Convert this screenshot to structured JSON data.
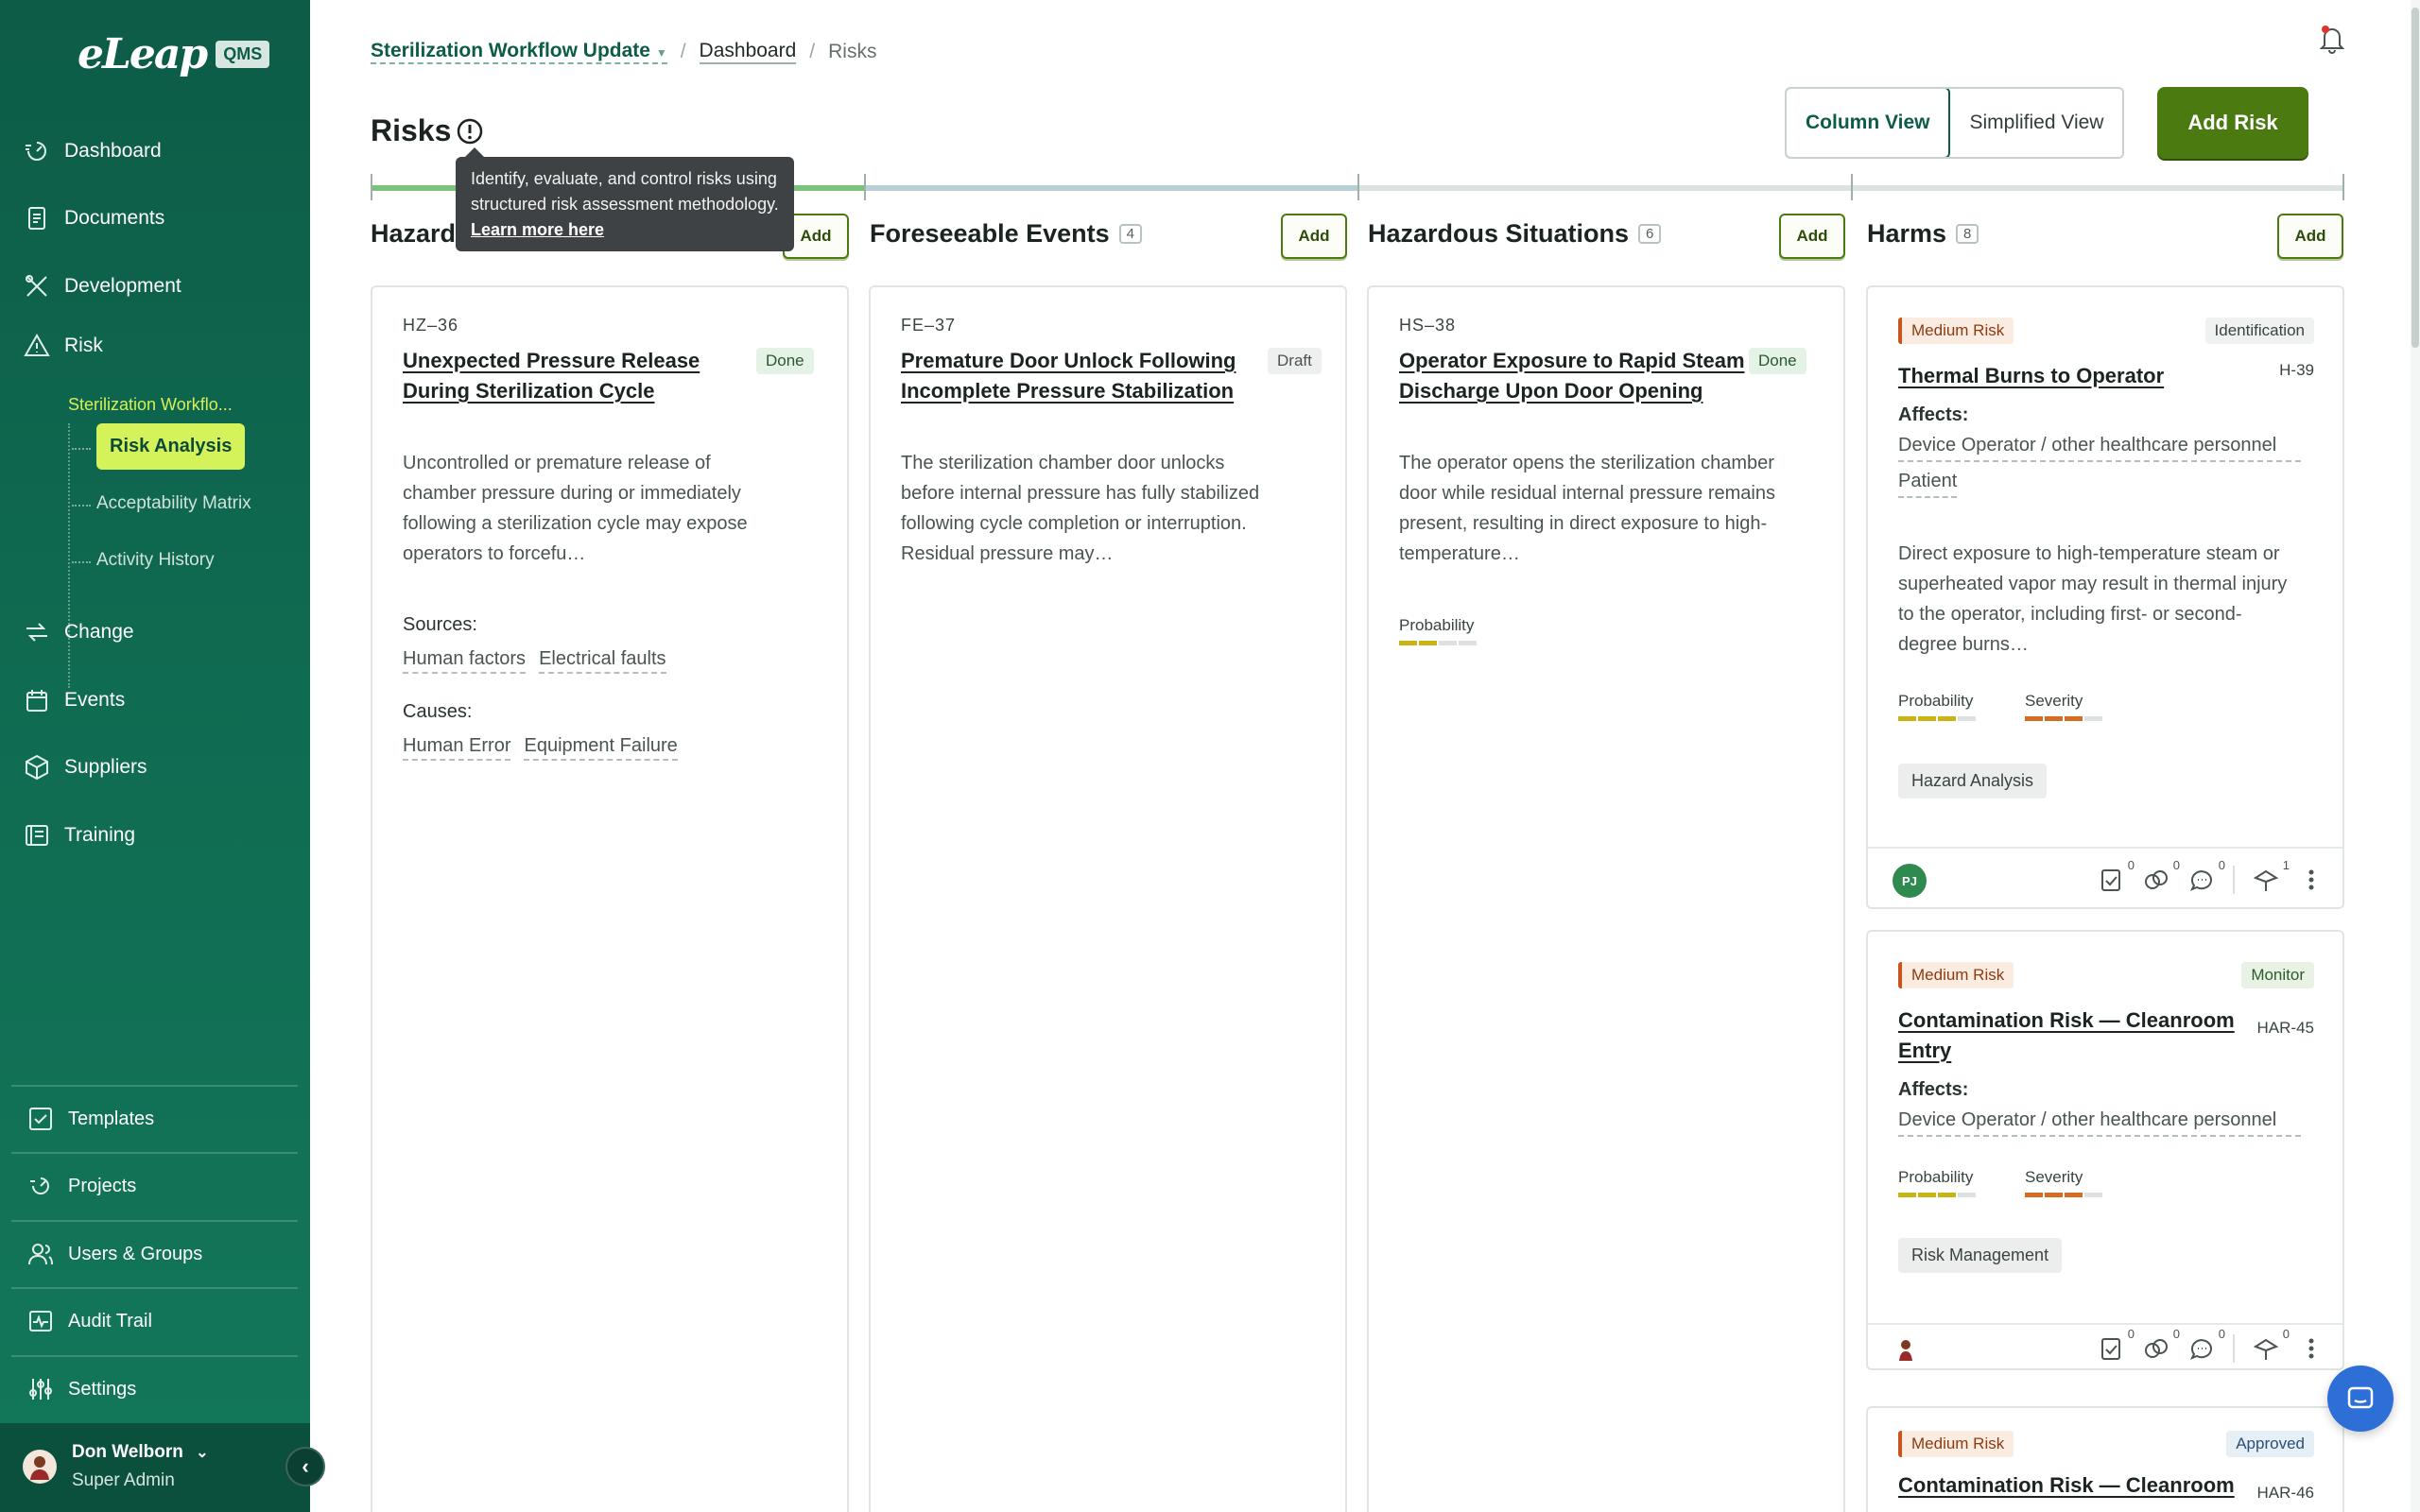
{
  "app": {
    "logo_text": "eLeap",
    "logo_badge": "QMS"
  },
  "sidebar": {
    "items": [
      {
        "label": "Dashboard",
        "icon": "dashboard-icon"
      },
      {
        "label": "Documents",
        "icon": "documents-icon"
      },
      {
        "label": "Development",
        "icon": "development-icon"
      },
      {
        "label": "Risk",
        "icon": "risk-icon"
      },
      {
        "label": "Change",
        "icon": "change-icon"
      },
      {
        "label": "Events",
        "icon": "events-icon"
      },
      {
        "label": "Suppliers",
        "icon": "suppliers-icon"
      },
      {
        "label": "Training",
        "icon": "training-icon"
      }
    ],
    "risk_sub": {
      "project": "Sterilization Workflo...",
      "active": "Risk Analysis",
      "links": [
        "Acceptability Matrix",
        "Activity History"
      ]
    },
    "bottom": [
      {
        "label": "Templates",
        "icon": "templates-icon"
      },
      {
        "label": "Projects",
        "icon": "projects-icon"
      },
      {
        "label": "Users & Groups",
        "icon": "users-icon"
      },
      {
        "label": "Audit Trail",
        "icon": "audit-icon"
      },
      {
        "label": "Settings",
        "icon": "settings-icon"
      }
    ],
    "user": {
      "name": "Don Welborn",
      "role": "Super Admin"
    }
  },
  "breadcrumb": {
    "project": "Sterilization Workflow Update",
    "link": "Dashboard",
    "current": "Risks"
  },
  "page": {
    "title": "Risks"
  },
  "tooltip": {
    "text": "Identify, evaluate, and control risks using structured risk assessment methodology.",
    "link": "Learn more here"
  },
  "view_toggle": {
    "column": "Column View",
    "simplified": "Simplified View",
    "active": "column"
  },
  "add_risk": "Add Risk",
  "columns": [
    {
      "title": "Hazards",
      "count": "",
      "add": "Add"
    },
    {
      "title": "Foreseeable Events",
      "count": "4",
      "add": "Add"
    },
    {
      "title": "Hazardous Situations",
      "count": "6",
      "add": "Add"
    },
    {
      "title": "Harms",
      "count": "8",
      "add": "Add"
    }
  ],
  "hazard_card": {
    "id": "HZ–36",
    "title": "Unexpected Pressure Release During Sterilization Cycle",
    "status": "Done",
    "desc": "Uncontrolled or premature release of chamber pressure during or immediately following a sterilization cycle may expose operators to forcefu…",
    "sources_label": "Sources:",
    "sources": [
      "Human factors",
      "Electrical faults"
    ],
    "causes_label": "Causes:",
    "causes": [
      "Human Error",
      "Equipment Failure"
    ]
  },
  "event_card": {
    "id": "FE–37",
    "title": "Premature Door Unlock Following Incomplete Pressure Stabilization",
    "status": "Draft",
    "desc": "The sterilization chamber door unlocks before internal pressure has fully stabilized following cycle completion or interruption. Residual pressure may…"
  },
  "situation_card": {
    "id": "HS–38",
    "title": "Operator Exposure to Rapid Steam Discharge Upon Door Opening",
    "status": "Done",
    "desc": "The operator opens the sterilization chamber door while residual internal pressure remains present, resulting in direct exposure to high-temperature…",
    "probability_label": "Probability",
    "probability": 2
  },
  "harm_cards": [
    {
      "risk": "Medium Risk",
      "status": "Identification",
      "id": "H-39",
      "title": "Thermal Burns to Operator",
      "affects_label": "Affects:",
      "affects": [
        "Device Operator / other healthcare personnel",
        "Patient"
      ],
      "desc": "Direct exposure to high-temperature steam or superheated vapor may result in thermal injury to the operator, including first- or second-degree burns…",
      "probability_label": "Probability",
      "severity_label": "Severity",
      "probability": 3,
      "severity": 3,
      "chip": "Hazard Analysis",
      "avatar": "PJ",
      "counts": {
        "tasks": "0",
        "links": "0",
        "comments": "0",
        "reviews": "1"
      }
    },
    {
      "risk": "Medium Risk",
      "status": "Monitor",
      "id": "HAR-45",
      "title": "Contamination Risk — Cleanroom Entry",
      "affects_label": "Affects:",
      "affects": [
        "Device Operator / other healthcare personnel"
      ],
      "probability_label": "Probability",
      "severity_label": "Severity",
      "probability": 3,
      "severity": 3,
      "chip": "Risk Management",
      "counts": {
        "tasks": "0",
        "links": "0",
        "comments": "0",
        "reviews": "0"
      }
    },
    {
      "risk": "Medium Risk",
      "status": "Approved",
      "id": "HAR-46",
      "title": "Contamination Risk — Cleanroom"
    }
  ],
  "colors": {
    "sidebar": "#0d5c47",
    "accent": "#d4f25a",
    "primary_button": "#4a7a10",
    "probability": "#c8b513",
    "severity": "#d66b22"
  }
}
